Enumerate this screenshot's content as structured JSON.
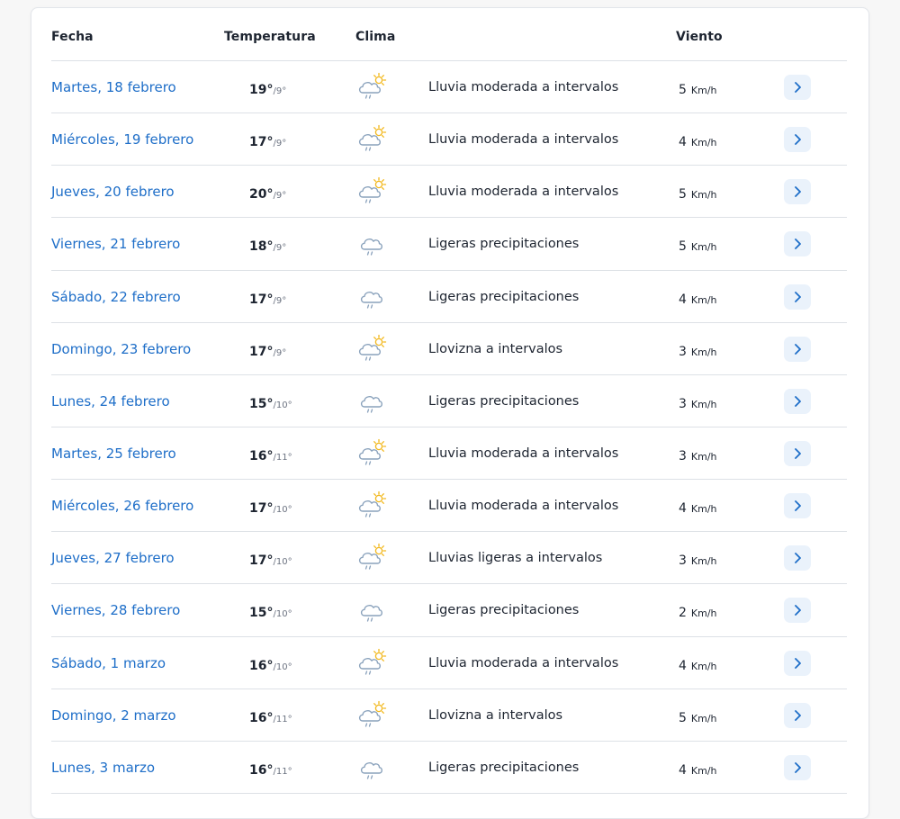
{
  "table": {
    "headers": {
      "fecha": "Fecha",
      "temperatura": "Temperatura",
      "clima": "Clima",
      "viento": "Viento"
    },
    "temp_separator": "/",
    "wind_unit": "Km/h",
    "colors": {
      "link": "#1e6ec8",
      "icon_cloud": "#8aa2bc",
      "icon_sun": "#f2b81d",
      "chevron_bg": "#eaf2fb",
      "chevron": "#1e6ec8"
    },
    "rows": [
      {
        "date": "Martes, 18 febrero",
        "max": "19°",
        "min": "9°",
        "icon": "cloud-sun-rain-icon",
        "desc": "Lluvia moderada a intervalos",
        "wind": "5"
      },
      {
        "date": "Miércoles, 19 febrero",
        "max": "17°",
        "min": "9°",
        "icon": "cloud-sun-rain-icon",
        "desc": "Lluvia moderada a intervalos",
        "wind": "4"
      },
      {
        "date": "Jueves, 20 febrero",
        "max": "20°",
        "min": "9°",
        "icon": "cloud-sun-rain-icon",
        "desc": "Lluvia moderada a intervalos",
        "wind": "5"
      },
      {
        "date": "Viernes, 21 febrero",
        "max": "18°",
        "min": "9°",
        "icon": "cloud-rain-icon",
        "desc": "Ligeras precipitaciones",
        "wind": "5"
      },
      {
        "date": "Sábado, 22 febrero",
        "max": "17°",
        "min": "9°",
        "icon": "cloud-rain-icon",
        "desc": "Ligeras precipitaciones",
        "wind": "4"
      },
      {
        "date": "Domingo, 23 febrero",
        "max": "17°",
        "min": "9°",
        "icon": "cloud-sun-rain-icon",
        "desc": "Llovizna a intervalos",
        "wind": "3"
      },
      {
        "date": "Lunes, 24 febrero",
        "max": "15°",
        "min": "10°",
        "icon": "cloud-rain-icon",
        "desc": "Ligeras precipitaciones",
        "wind": "3"
      },
      {
        "date": "Martes, 25 febrero",
        "max": "16°",
        "min": "11°",
        "icon": "cloud-sun-rain-icon",
        "desc": "Lluvia moderada a intervalos",
        "wind": "3"
      },
      {
        "date": "Miércoles, 26 febrero",
        "max": "17°",
        "min": "10°",
        "icon": "cloud-sun-rain-icon",
        "desc": "Lluvia moderada a intervalos",
        "wind": "4"
      },
      {
        "date": "Jueves, 27 febrero",
        "max": "17°",
        "min": "10°",
        "icon": "cloud-sun-rain-icon",
        "desc": "Lluvias ligeras a intervalos",
        "wind": "3"
      },
      {
        "date": "Viernes, 28 febrero",
        "max": "15°",
        "min": "10°",
        "icon": "cloud-rain-icon",
        "desc": "Ligeras precipitaciones",
        "wind": "2"
      },
      {
        "date": "Sábado, 1 marzo",
        "max": "16°",
        "min": "10°",
        "icon": "cloud-sun-rain-icon",
        "desc": "Lluvia moderada a intervalos",
        "wind": "4"
      },
      {
        "date": "Domingo, 2 marzo",
        "max": "16°",
        "min": "11°",
        "icon": "cloud-sun-rain-icon",
        "desc": "Llovizna a intervalos",
        "wind": "5"
      },
      {
        "date": "Lunes, 3 marzo",
        "max": "16°",
        "min": "11°",
        "icon": "cloud-rain-icon",
        "desc": "Ligeras precipitaciones",
        "wind": "4"
      }
    ]
  }
}
